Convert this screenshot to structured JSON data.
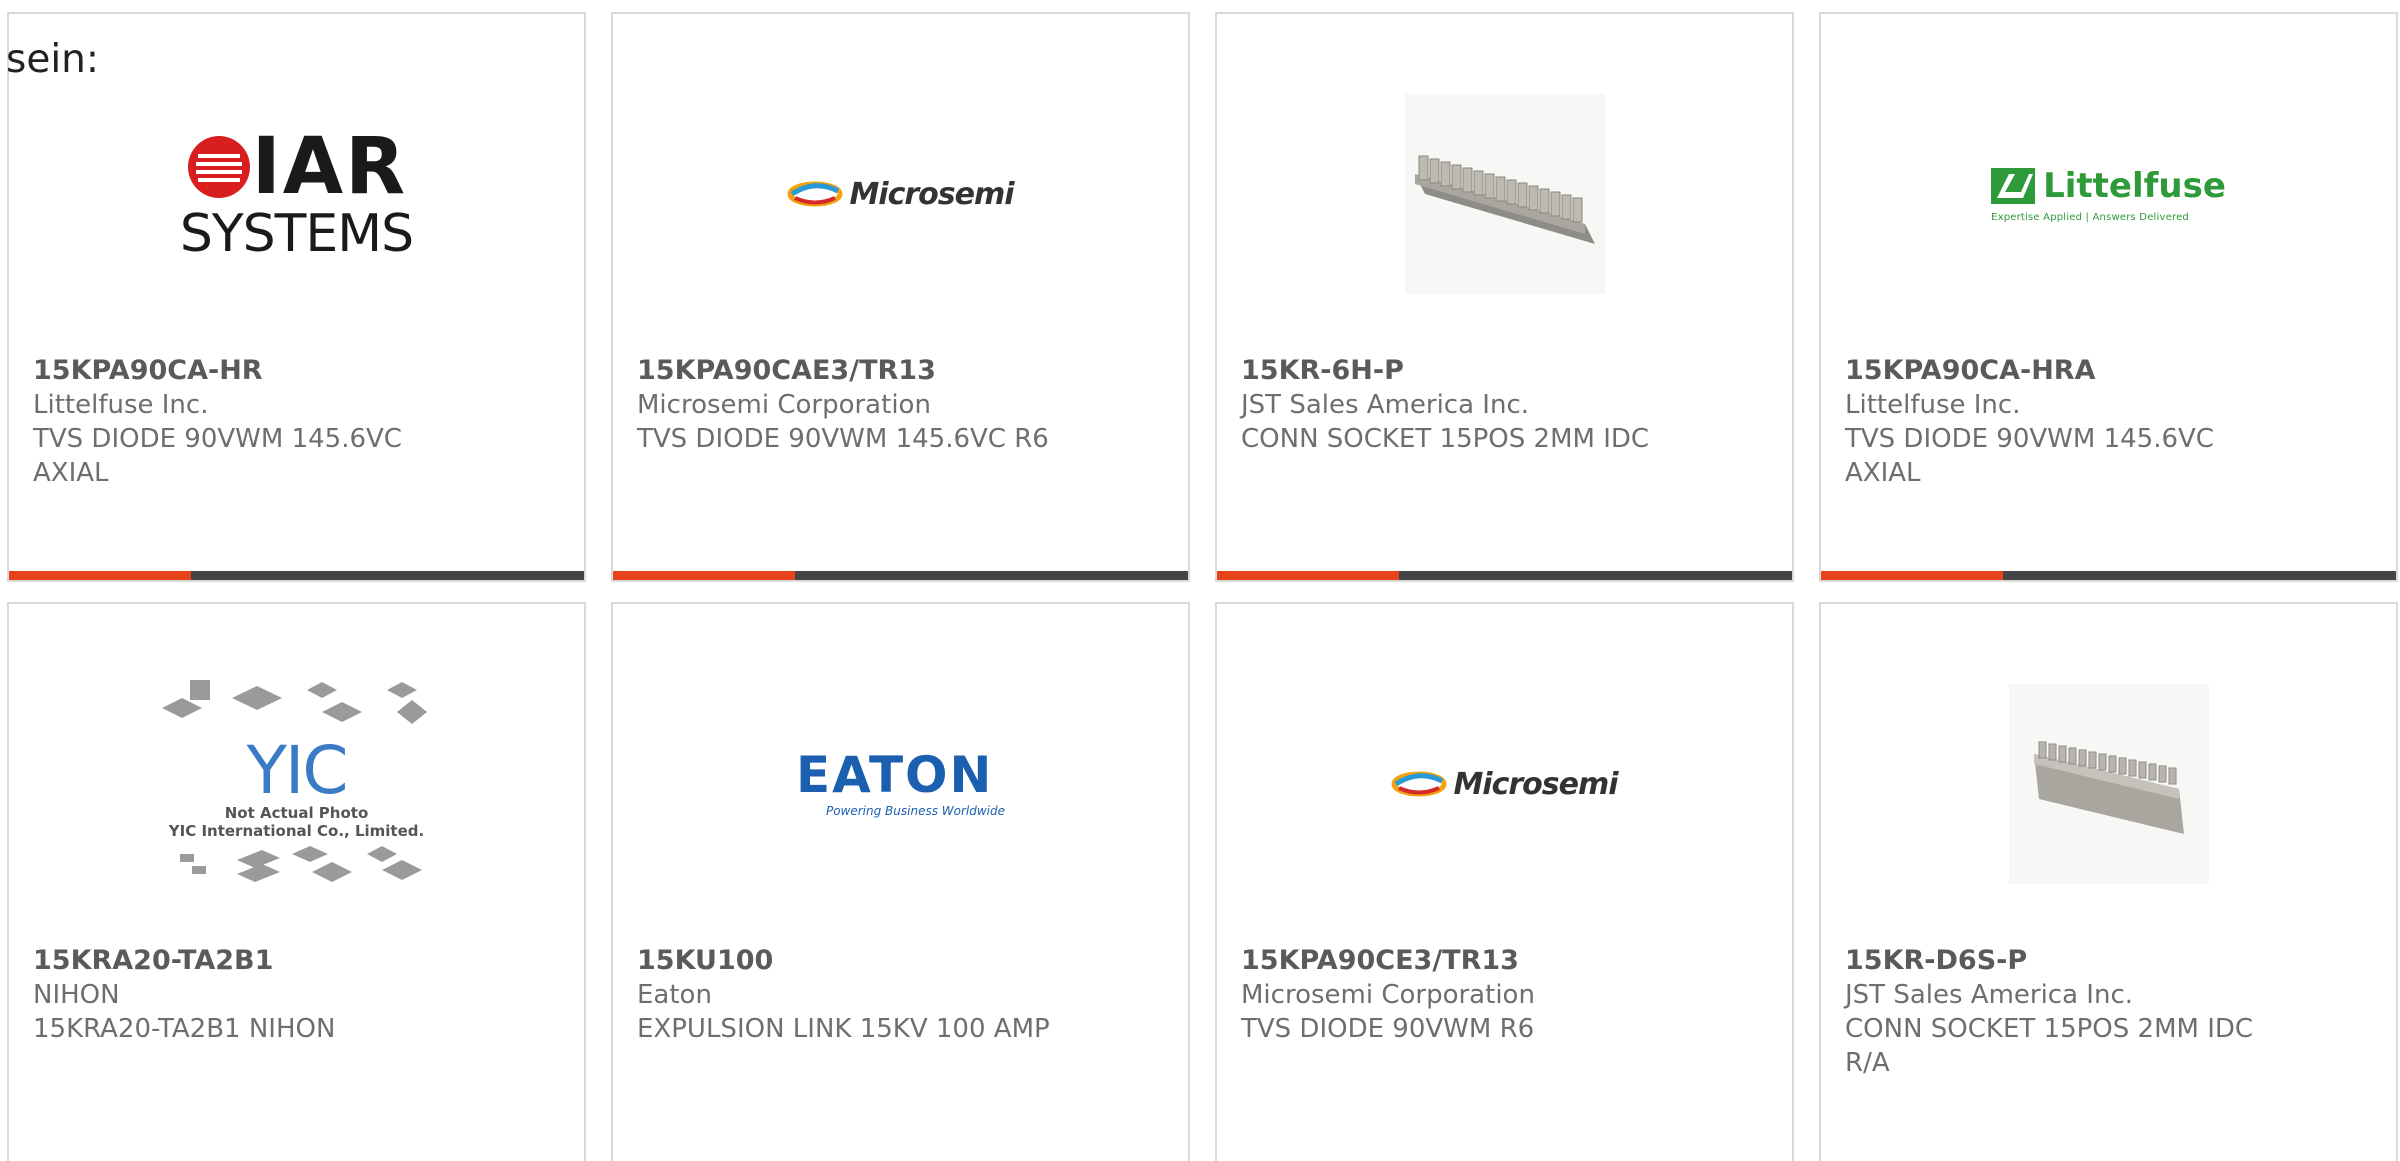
{
  "lead_text": "sein:",
  "colors": {
    "accent": "#e8421a",
    "bar": "#444444",
    "border": "#d9d9d9"
  },
  "cards": [
    {
      "part": "15KPA90CA-HR",
      "manufacturer": "Littelfuse Inc.",
      "description": "TVS DIODE 90VWM 145.6VC AXIAL",
      "image": "iar-systems-logo",
      "logo_text": "IAR",
      "logo_sub": "SYSTEMS"
    },
    {
      "part": "15KPA90CAE3/TR13",
      "manufacturer": "Microsemi Corporation",
      "description": "TVS DIODE 90VWM 145.6VC R6",
      "image": "microsemi-logo",
      "logo_text": "Microsemi"
    },
    {
      "part": "15KR-6H-P",
      "manufacturer": "JST Sales America Inc.",
      "description": "CONN SOCKET 15POS 2MM IDC",
      "image": "connector-photo"
    },
    {
      "part": "15KPA90CA-HRA",
      "manufacturer": "Littelfuse Inc.",
      "description": "TVS DIODE 90VWM 145.6VC AXIAL",
      "image": "littelfuse-logo",
      "logo_text": "Littelfuse",
      "logo_sub": "Expertise Applied | Answers Delivered"
    },
    {
      "part": "15KRA20-TA2B1",
      "manufacturer": "NIHON",
      "description": "15KRA20-TA2B1 NIHON",
      "image": "yic-placeholder",
      "logo_text": "YIC",
      "logo_sub": "Not Actual Photo\nYIC International Co., Limited."
    },
    {
      "part": "15KU100",
      "manufacturer": "Eaton",
      "description": "EXPULSION LINK 15KV 100 AMP",
      "image": "eaton-logo",
      "logo_text": "EATON",
      "logo_sub": "Powering Business Worldwide"
    },
    {
      "part": "15KPA90CE3/TR13",
      "manufacturer": "Microsemi Corporation",
      "description": "TVS DIODE 90VWM R6",
      "image": "microsemi-logo",
      "logo_text": "Microsemi"
    },
    {
      "part": "15KR-D6S-P",
      "manufacturer": "JST Sales America Inc.",
      "description": "CONN SOCKET 15POS 2MM IDC R/A",
      "image": "connector-photo"
    }
  ]
}
